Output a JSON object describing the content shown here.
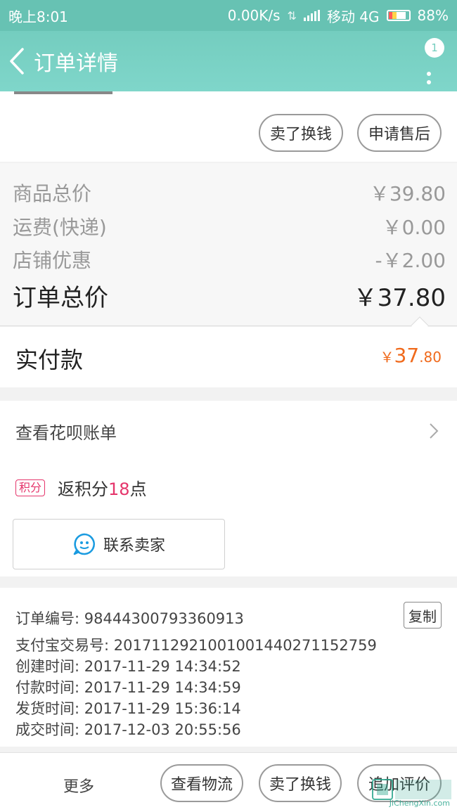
{
  "status_bar": {
    "time": "晚上8:01",
    "speed": "0.00K/s",
    "carrier": "移动 4G",
    "battery": "88%"
  },
  "nav": {
    "title": "订单详情",
    "badge_count": "1"
  },
  "top_actions": {
    "sell_label": "卖了换钱",
    "after_sale_label": "申请售后"
  },
  "prices": {
    "items": [
      {
        "label": "商品总价",
        "value": "￥39.80"
      },
      {
        "label": "运费(快递)",
        "value": "￥0.00"
      },
      {
        "label": "店铺优惠",
        "value": "-￥2.00"
      }
    ],
    "total_label": "订单总价",
    "total_value": "￥37.80"
  },
  "paid": {
    "label": "实付款",
    "currency": "￥",
    "int_part": "37",
    "dec_part": ".80"
  },
  "huabei": {
    "label": "查看花呗账单"
  },
  "points": {
    "tag": "积分",
    "prefix": "返积分",
    "number": "18",
    "suffix": "点"
  },
  "contact": {
    "label": "联系卖家"
  },
  "order_info": {
    "copy_label": "复制",
    "lines": [
      "订单编号: 98444300793360913",
      "支付宝交易号: 2017112921001001440271152759",
      "创建时间: 2017-11-29 14:34:52",
      "付款时间: 2017-11-29 14:34:59",
      "发货时间: 2017-11-29 15:36:14",
      "成交时间: 2017-12-03 20:55:56"
    ]
  },
  "bottom_bar": {
    "more_label": "更多",
    "logistics_label": "查看物流",
    "sell_label": "卖了换钱",
    "review_label": "追加评价"
  },
  "watermark": {
    "text": "JiChengXin.com"
  },
  "colors": {
    "header": "#74cdbf",
    "accent_orange": "#f06a1c",
    "points_red": "#e5356b"
  }
}
